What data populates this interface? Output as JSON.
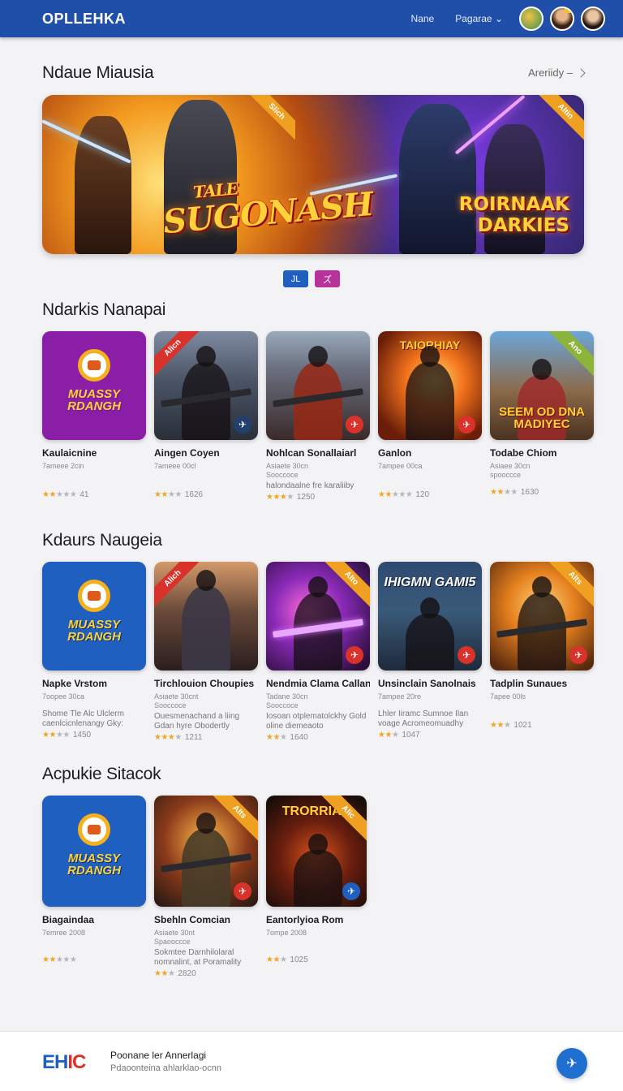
{
  "header": {
    "brand": "OPLLEHKA",
    "nav": [
      {
        "label": "Nane"
      },
      {
        "label": "Pagarae ⌄"
      }
    ]
  },
  "featured": {
    "title": "Ndaue Miausia",
    "see_all": "Areriidy –",
    "banner_title": "SUGONASH",
    "banner_title_top": "TALE",
    "banner_title_right": "ROIRNAAK DARKIES",
    "banner_ribbon_left": "Slich",
    "banner_ribbon_right": "Altin",
    "dots": [
      "JL",
      "ズ"
    ]
  },
  "section1": {
    "title": "Ndarkis Nanapai",
    "cards": [
      {
        "title": "Kaulaicnine",
        "sub": "7ameee 2cin",
        "desc": "",
        "rating": 2,
        "count": "41",
        "thumb_text": "MUASSY RDANGH",
        "ribbon": ""
      },
      {
        "title": "Aingen Coyen",
        "sub": "7ameee 00cl",
        "desc": "",
        "rating": 3,
        "count": "1626",
        "thumb_text": "",
        "ribbon": "Alicn"
      },
      {
        "title": "Nohlcan Sonallaiarl",
        "sub": "Asiaete 30cn\nSooccoce",
        "desc": "halondaalne fre karaliiby",
        "rating": 3,
        "count": "1250",
        "thumb_text": "",
        "ribbon": ""
      },
      {
        "title": "Ganlon",
        "sub": "7ampee 00ca",
        "desc": "",
        "rating": 2,
        "count": "120",
        "thumb_text": "TAIORHIAY",
        "ribbon": ""
      },
      {
        "title": "Todabe Chiom",
        "sub": "Asiaee 30cn\nspooccce",
        "desc": "",
        "rating": 3,
        "count": "1630",
        "thumb_text": "SEEM OD DNA MADIYEC",
        "ribbon": "Ano"
      }
    ]
  },
  "section2": {
    "title": "Kdaurs Naugeia",
    "cards": [
      {
        "title": "Napke Vrstom",
        "sub": "7oopee 30ca",
        "desc": "Shome Tle Alc Ulclerm caenlcicnlenangy Gky:",
        "rating": 2,
        "count": "1450",
        "thumb_text": "MUASSY RDANGH",
        "ribbon": ""
      },
      {
        "title": "Tirchlouion Choupies",
        "sub": "Asiaete 30cnt\nSooccoce",
        "desc": "Ouesmenachand a liing Gdan hyre Obodertly",
        "rating": 3,
        "count": "1211",
        "thumb_text": "",
        "ribbon": "Alich"
      },
      {
        "title": "Nendmia Clama Callan",
        "sub": "Tadane 30cn\nSooccoce",
        "desc": "Iosoan otplematolckhy Gold oline diemeaoto",
        "rating": 3,
        "count": "1640",
        "thumb_text": "",
        "ribbon": "Alto"
      },
      {
        "title": "Unsinclain Sanolnais",
        "sub": "7ampee 20re",
        "desc": "Lhler Iiramc Sumnoe Ilan voage Acromeomuadhy",
        "rating": 2,
        "count": "1047",
        "thumb_text": "IHIGMN GAMI5",
        "ribbon": ""
      },
      {
        "title": "Tadplin Sunaues",
        "sub": "7apee 00ls",
        "desc": "",
        "rating": 3,
        "count": "1021",
        "thumb_text": "",
        "ribbon": "Alts"
      }
    ]
  },
  "section3": {
    "title": "Acpukie Sitacok",
    "cards": [
      {
        "title": "Biagaindaa",
        "sub": "7emree 2008",
        "desc": "",
        "rating": 2,
        "count": "",
        "thumb_text": "MUASSY RDANGH",
        "ribbon": ""
      },
      {
        "title": "Sbehln Comcian",
        "sub": "Asiaete 30nt\nSpaooccce",
        "desc": "Sokmtee Darnhilolaral nomnalint, at Poramality",
        "rating": 3,
        "count": "2820",
        "thumb_text": "",
        "ribbon": "Alts"
      },
      {
        "title": "Eantorlyioa Rom",
        "sub": "7ompe 2008",
        "desc": "",
        "rating": 3,
        "count": "1025",
        "thumb_text": "TRORRIAH",
        "ribbon": "Alic"
      }
    ]
  },
  "footer": {
    "logo_a": "EH",
    "logo_b": "IC",
    "title": "Poonane ler Annerlagi",
    "sub": "Pdaoonteina ahlarklao-ocnn"
  }
}
